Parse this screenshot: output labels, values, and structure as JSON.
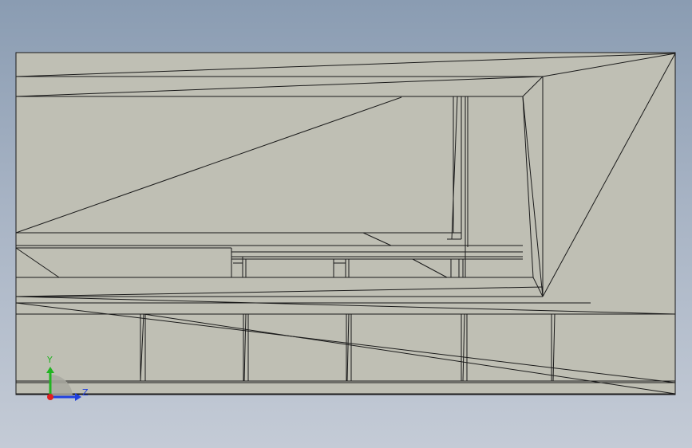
{
  "viewport": {
    "background_top": "#8a9cb2",
    "background_bottom": "#c4cbd6"
  },
  "model": {
    "face_color": "#bfbfb4",
    "edge_color": "#1a1a1a"
  },
  "triad": {
    "y_label": "Y",
    "z_label": "Z",
    "y_color": "#22b422",
    "z_color": "#2040e0",
    "x_color": "#e02020"
  }
}
